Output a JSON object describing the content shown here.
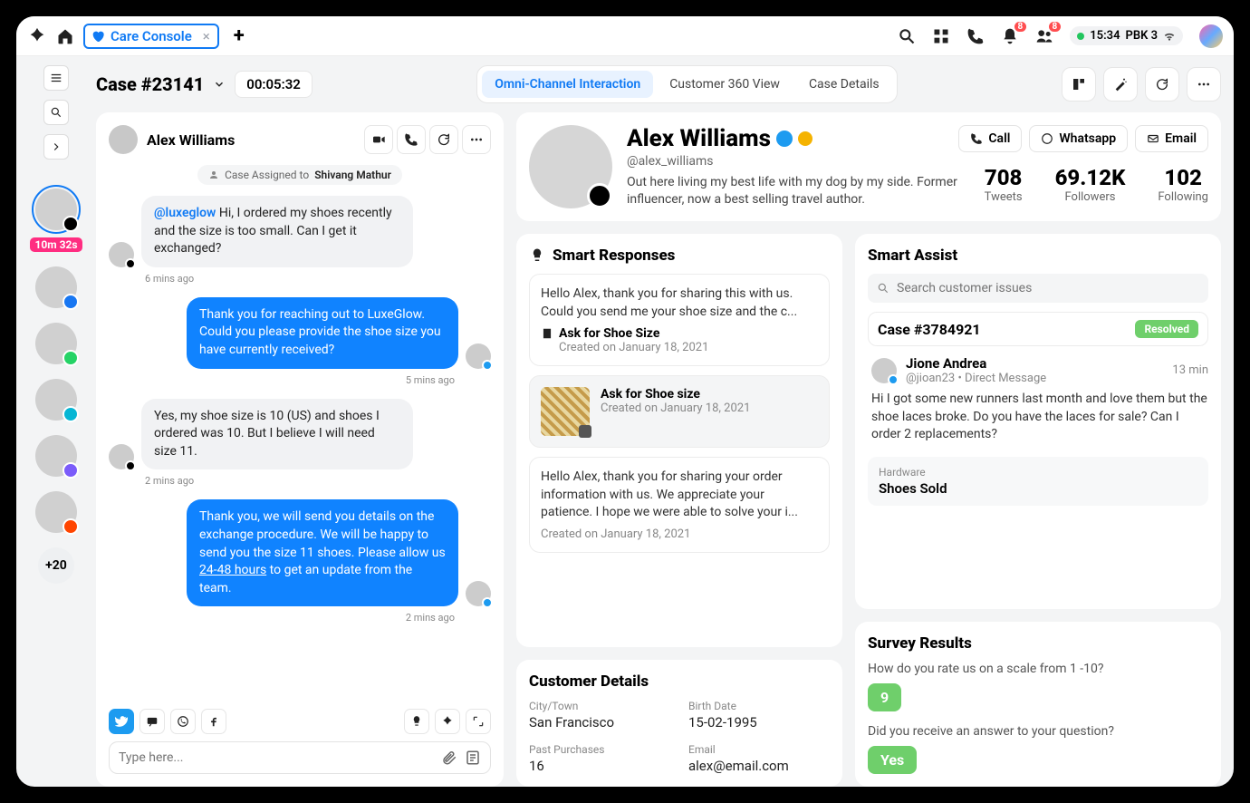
{
  "topbar": {
    "tab_label": "Care Console",
    "time": "15:34",
    "workspace": "PBK 3",
    "notif_badge": "8",
    "people_badge": "8"
  },
  "rail": {
    "timer": "10m 32s",
    "more": "+20"
  },
  "header": {
    "case": "Case #23141",
    "elapsed": "00:05:32",
    "tabs": [
      "Omni-Channel Interaction",
      "Customer 360 View",
      "Case Details"
    ]
  },
  "chat": {
    "name": "Alex Williams",
    "assigned_prefix": "Case Assigned to",
    "assigned_to": "Shivang Mathur",
    "messages": [
      {
        "dir": "in",
        "mention": "@luxeglow",
        "text": "Hi, I ordered my shoes recently and the size is too small. Can I get it exchanged?",
        "ts": "6 mins ago"
      },
      {
        "dir": "out",
        "text": "Thank you for reaching out to LuxeGlow. Could you please provide the shoe size you have currently received?",
        "ts": "5 mins ago"
      },
      {
        "dir": "in",
        "text": "Yes, my shoe size is 10 (US) and shoes I ordered was 10. But I believe I will need size 11.",
        "ts": "2 mins ago"
      },
      {
        "dir": "out",
        "text_a": "Thank you, we will send you details on the exchange procedure. We will be happy to send you the size 11 shoes. Please allow us ",
        "text_u": "24-48 hours",
        "text_b": " to get an update from the team.",
        "ts": "2 mins ago"
      }
    ],
    "compose_placeholder": "Type here..."
  },
  "profile": {
    "name": "Alex Williams",
    "handle": "@alex_williams",
    "bio": "Out here living my best life with my dog by my side. Former influencer, now a best selling travel author.",
    "buttons": {
      "call": "Call",
      "whatsapp": "Whatsapp",
      "email": "Email"
    },
    "stats": [
      {
        "n": "708",
        "l": "Tweets"
      },
      {
        "n": "69.12K",
        "l": "Followers"
      },
      {
        "n": "102",
        "l": "Following"
      }
    ]
  },
  "smart_responses": {
    "title": "Smart Responses",
    "items": [
      {
        "preview": "Hello Alex, thank you for sharing this with us. Could you send me your shoe size and the c...",
        "title": "Ask for Shoe Size",
        "sub": "Created on January 18, 2021"
      },
      {
        "title": "Ask for Shoe size",
        "sub": "Created on January 18, 2021"
      },
      {
        "preview": "Hello Alex, thank you for sharing your order information with us. We appreciate your patience. I hope we were able to solve your i...",
        "sub": "Created on January 18, 2021"
      }
    ]
  },
  "customer_details": {
    "title": "Customer Details",
    "fields": [
      {
        "l": "City/Town",
        "v": "San Francisco"
      },
      {
        "l": "Birth Date",
        "v": "15-02-1995"
      },
      {
        "l": "Past Purchases",
        "v": "16"
      },
      {
        "l": "Email",
        "v": "alex@email.com"
      }
    ]
  },
  "smart_assist": {
    "title": "Smart Assist",
    "search_placeholder": "Search customer issues",
    "case_id": "Case #3784921",
    "status": "Resolved",
    "msg": {
      "name": "Jione Andrea",
      "handle": "@jioan23 • Direct Message",
      "time": "13 min",
      "text": "Hi I got some new runners last month and love them but the shoe laces broke. Do you have the laces for sale? Can I order 2 replacements?"
    },
    "category_l": "Hardware",
    "category_v": "Shoes Sold"
  },
  "survey": {
    "title": "Survey Results",
    "q1": "How do you rate us on a scale from 1 -10?",
    "a1": "9",
    "q2": "Did you receive an answer to your question?",
    "a2": "Yes"
  }
}
